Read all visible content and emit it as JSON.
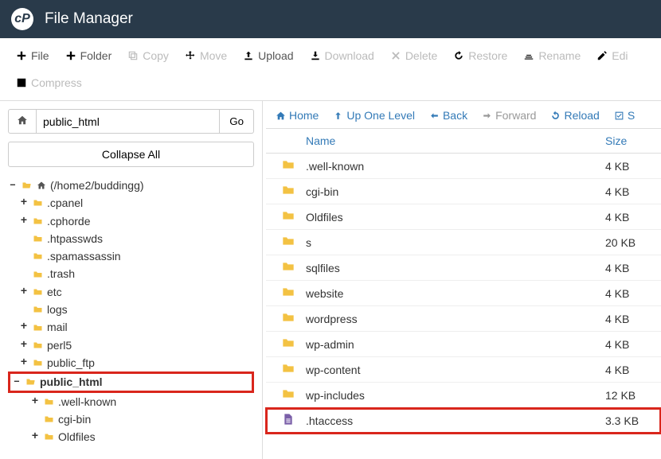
{
  "header": {
    "title": "File Manager"
  },
  "toolbar": {
    "file": "File",
    "folder": "Folder",
    "copy": "Copy",
    "move": "Move",
    "upload": "Upload",
    "download": "Download",
    "delete": "Delete",
    "restore": "Restore",
    "rename": "Rename",
    "edit": "Edi",
    "compress": "Compress"
  },
  "sidebar": {
    "path_value": "public_html",
    "go_label": "Go",
    "collapse_label": "Collapse All",
    "tree": [
      {
        "indent": 0,
        "toggle": "–",
        "icon": "folder-open-home",
        "label": "(/home2/buddingg)"
      },
      {
        "indent": 1,
        "toggle": "+",
        "icon": "folder",
        "label": ".cpanel"
      },
      {
        "indent": 1,
        "toggle": "+",
        "icon": "folder",
        "label": ".cphorde"
      },
      {
        "indent": 1,
        "toggle": "",
        "icon": "folder",
        "label": ".htpasswds"
      },
      {
        "indent": 1,
        "toggle": "",
        "icon": "folder",
        "label": ".spamassassin"
      },
      {
        "indent": 1,
        "toggle": "",
        "icon": "folder",
        "label": ".trash"
      },
      {
        "indent": 1,
        "toggle": "+",
        "icon": "folder",
        "label": "etc"
      },
      {
        "indent": 1,
        "toggle": "",
        "icon": "folder",
        "label": "logs"
      },
      {
        "indent": 1,
        "toggle": "+",
        "icon": "folder",
        "label": "mail"
      },
      {
        "indent": 1,
        "toggle": "+",
        "icon": "folder",
        "label": "perl5"
      },
      {
        "indent": 1,
        "toggle": "+",
        "icon": "folder",
        "label": "public_ftp"
      },
      {
        "indent": 1,
        "toggle": "–",
        "icon": "folder-open",
        "label": "public_html",
        "highlight": true
      },
      {
        "indent": 2,
        "toggle": "+",
        "icon": "folder",
        "label": ".well-known"
      },
      {
        "indent": 2,
        "toggle": "",
        "icon": "folder",
        "label": "cgi-bin"
      },
      {
        "indent": 2,
        "toggle": "+",
        "icon": "folder",
        "label": "Oldfiles"
      }
    ]
  },
  "content_nav": {
    "home": "Home",
    "up": "Up One Level",
    "back": "Back",
    "forward": "Forward",
    "reload": "Reload",
    "select_all": "S"
  },
  "file_table": {
    "col_name": "Name",
    "col_size": "Size",
    "rows": [
      {
        "icon": "folder",
        "name": ".well-known",
        "size": "4 KB"
      },
      {
        "icon": "folder",
        "name": "cgi-bin",
        "size": "4 KB"
      },
      {
        "icon": "folder",
        "name": "Oldfiles",
        "size": "4 KB"
      },
      {
        "icon": "folder",
        "name": "s",
        "size": "20 KB"
      },
      {
        "icon": "folder",
        "name": "sqlfiles",
        "size": "4 KB"
      },
      {
        "icon": "folder",
        "name": "website",
        "size": "4 KB"
      },
      {
        "icon": "folder",
        "name": "wordpress",
        "size": "4 KB"
      },
      {
        "icon": "folder",
        "name": "wp-admin",
        "size": "4 KB"
      },
      {
        "icon": "folder",
        "name": "wp-content",
        "size": "4 KB"
      },
      {
        "icon": "folder",
        "name": "wp-includes",
        "size": "12 KB"
      },
      {
        "icon": "file",
        "name": ".htaccess",
        "size": "3.3 KB",
        "highlight": true
      }
    ]
  }
}
